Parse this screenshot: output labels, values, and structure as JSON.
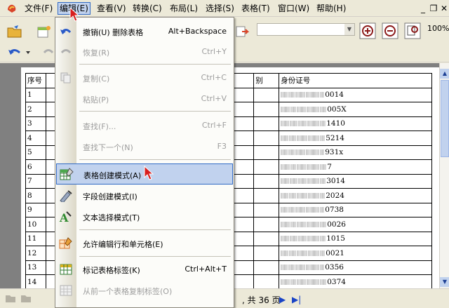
{
  "menubar": {
    "items": [
      {
        "label": "文件(F)"
      },
      {
        "label": "编辑(E)"
      },
      {
        "label": "查看(V)"
      },
      {
        "label": "转换(C)"
      },
      {
        "label": "布局(L)"
      },
      {
        "label": "选择(S)"
      },
      {
        "label": "表格(T)"
      },
      {
        "label": "窗口(W)"
      },
      {
        "label": "帮助(H)"
      }
    ]
  },
  "toolbar": {
    "zoom": "100%"
  },
  "edit_menu": {
    "items": [
      {
        "label": "撤销(U) 删除表格",
        "shortcut": "Alt+Backspace",
        "enabled": true
      },
      {
        "label": "恢复(R)",
        "shortcut": "Ctrl+Y",
        "enabled": false
      },
      {
        "label": "复制(C)",
        "shortcut": "Ctrl+C",
        "enabled": false
      },
      {
        "label": "粘贴(P)",
        "shortcut": "Ctrl+V",
        "enabled": false
      },
      {
        "label": "查找(F)...",
        "shortcut": "Ctrl+F",
        "enabled": false
      },
      {
        "label": "查找下一个(N)",
        "shortcut": "F3",
        "enabled": false
      },
      {
        "label": "表格创建模式(A)",
        "shortcut": "",
        "enabled": true,
        "highlighted": true
      },
      {
        "label": "字段创建模式(I)",
        "shortcut": "",
        "enabled": true
      },
      {
        "label": "文本选择模式(T)",
        "shortcut": "",
        "enabled": true
      },
      {
        "label": "允许编辑行和单元格(E)",
        "shortcut": "",
        "enabled": true
      },
      {
        "label": "标记表格标签(K)",
        "shortcut": "Ctrl+Alt+T",
        "enabled": true
      },
      {
        "label": "从前一个表格复制标签(O)",
        "shortcut": "",
        "enabled": false
      }
    ]
  },
  "document": {
    "headers": [
      "序号",
      "",
      "别",
      "身份证号"
    ],
    "rows": [
      {
        "no": "1",
        "id_tail": "0014"
      },
      {
        "no": "2",
        "id_tail": "005X"
      },
      {
        "no": "3",
        "id_tail": "1410"
      },
      {
        "no": "4",
        "id_tail": "5214"
      },
      {
        "no": "5",
        "id_tail": "931x"
      },
      {
        "no": "6",
        "id_tail": "7"
      },
      {
        "no": "7",
        "id_tail": "3014"
      },
      {
        "no": "8",
        "id_tail": "2024"
      },
      {
        "no": "9",
        "id_tail": "0738"
      },
      {
        "no": "10",
        "id_tail": "0026"
      },
      {
        "no": "11",
        "id_tail": "1015"
      },
      {
        "no": "12",
        "id_tail": "0021"
      },
      {
        "no": "13",
        "id_tail": "0356"
      },
      {
        "no": "14",
        "id_tail": "0374"
      }
    ]
  },
  "statusbar": {
    "total_pages": ", 共 36 页"
  },
  "colors": {
    "highlight": "#c1d2ee",
    "highlight_border": "#316ac5",
    "menubar_bg": "#ece9d8"
  }
}
